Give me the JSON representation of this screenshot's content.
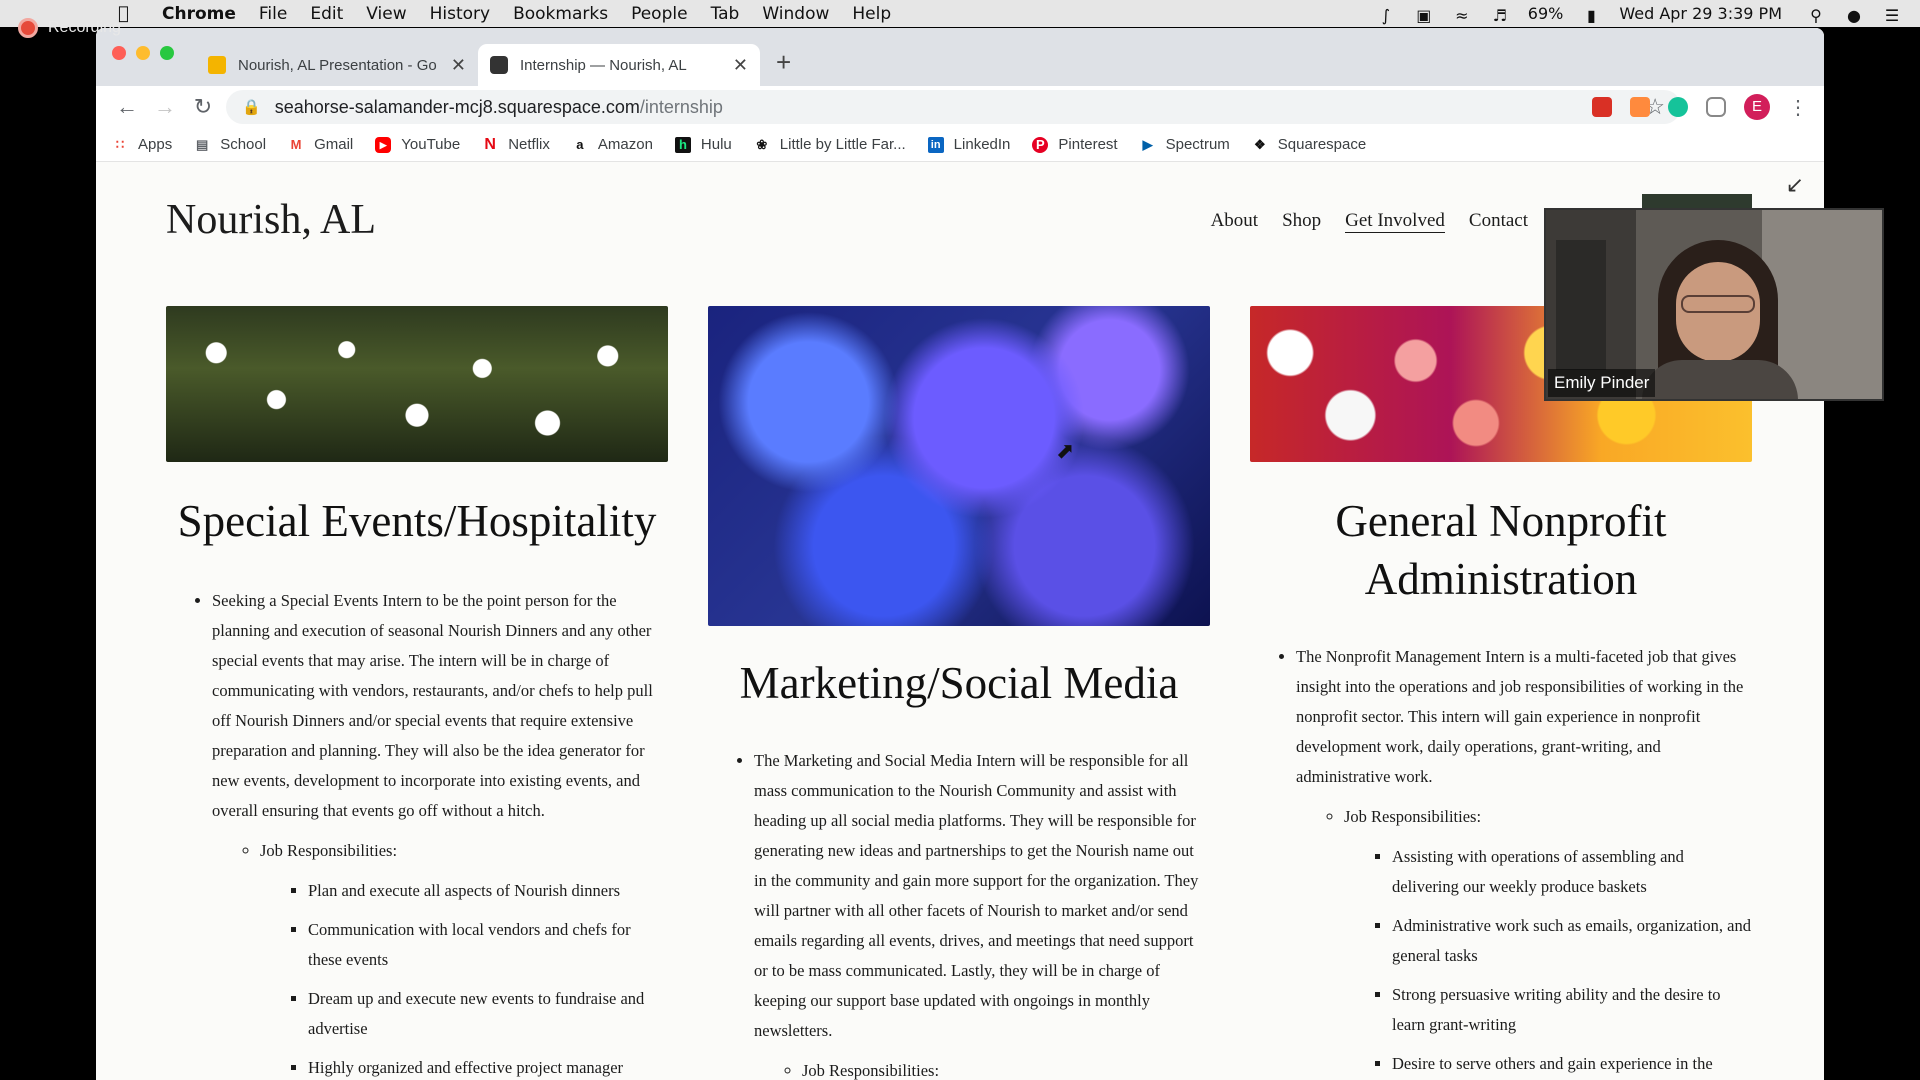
{
  "recording": {
    "label": "Recording"
  },
  "menubar": {
    "app": "Chrome",
    "items": [
      "File",
      "Edit",
      "View",
      "History",
      "Bookmarks",
      "People",
      "Tab",
      "Window",
      "Help"
    ],
    "battery": "69%",
    "clock": "Wed Apr 29  3:39 PM"
  },
  "browser": {
    "tabs": [
      {
        "title": "Nourish, AL Presentation - Go",
        "favicon": "slides-icon"
      },
      {
        "title": "Internship — Nourish, AL",
        "favicon": "squarespace-icon"
      }
    ],
    "url_host": "seahorse-salamander-mcj8.squarespace.com",
    "url_path": "/internship",
    "profile_initial": "E",
    "bookmarks": [
      "Apps",
      "School",
      "Gmail",
      "YouTube",
      "Netflix",
      "Amazon",
      "Hulu",
      "Little by Little Far...",
      "LinkedIn",
      "Pinterest",
      "Spectrum",
      "Squarespace"
    ]
  },
  "site": {
    "title": "Nourish, AL",
    "nav": [
      "About",
      "Shop",
      "Get Involved",
      "Contact"
    ],
    "current_nav": "Get Involved"
  },
  "sections": {
    "events": {
      "heading": "Special Events/Hospitality",
      "summary": "Seeking a Special Events Intern to be the point person for the planning and execution of seasonal Nourish Dinners and any other special events that may arise. The intern will be in charge of communicating with vendors, restaurants, and/or chefs to help pull off Nourish Dinners and/or special events that require extensive preparation and planning. They will also be the idea generator for new events, development to incorporate into existing events, and overall ensuring that events go off without a hitch.",
      "resp_label": "Job Responsibilities:",
      "resp": [
        "Plan and execute all aspects of Nourish dinners",
        "Communication with local vendors and chefs for these events",
        "Dream up and execute new events to fundraise and advertise",
        "Highly organized and effective project manager"
      ]
    },
    "marketing": {
      "heading": "Marketing/Social Media",
      "summary": "The Marketing and Social Media Intern will be responsible for all mass communication to the Nourish Community and assist with heading up all social media platforms. They will be responsible for generating new ideas and partnerships to get the Nourish name out in the community and gain more support for the organization. They will partner with all other facets of Nourish to market and/or send emails regarding all events, drives, and meetings that need support or to be mass communicated. Lastly, they will be in charge of keeping our support base updated with ongoings in monthly newsletters.",
      "resp_label": "Job Responsibilities:"
    },
    "admin": {
      "heading": "General Nonprofit Administration",
      "summary": "The Nonprofit Management Intern is a multi-faceted job that gives insight into the operations and job responsibilities of working in the nonprofit sector. This intern will gain experience in nonprofit development work, daily operations, grant-writing, and administrative work.",
      "resp_label": "Job Responsibilities:",
      "resp": [
        "Assisting with operations of assembling and delivering our weekly produce baskets",
        "Administrative work such as emails, organization, and general tasks",
        "Strong persuasive writing ability and the desire to learn grant-writing",
        "Desire to serve others and gain experience in the nonprofit sector"
      ]
    }
  },
  "video": {
    "name": "Emily Pinder"
  }
}
